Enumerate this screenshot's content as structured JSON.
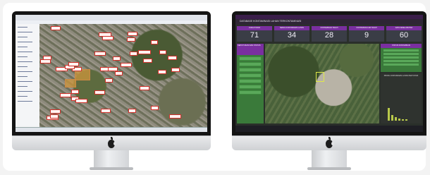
{
  "left_monitor": {
    "gis_app": {
      "panel_lines": 16,
      "parcel_labels": 40
    }
  },
  "right_monitor": {
    "dashboard": {
      "title": "DATABASE KONTAMINASI LAHAN TERKONTAMINASI",
      "stats": [
        {
          "label": "JUMLAH DATA",
          "value": "71"
        },
        {
          "label": "SEMUA KONTAMINASI LAHAN",
          "value": "34"
        },
        {
          "label": "KONTAMINASI TANAH",
          "value": "28"
        },
        {
          "label": "KONTAMINASI AIR TANAH",
          "value": "9"
        },
        {
          "label": "DATA KESELURUHAN",
          "value": "60"
        }
      ],
      "left_panel_title": "KEPUTUSAN DAN STATUS",
      "right_panel_title": "STATUS KONTAMINASI",
      "chart_title": "PROFIL KONTAMINASI LAHAN PER TAHUN",
      "accent_purple": "#7a2fa0",
      "accent_green": "#3a7a3a"
    }
  }
}
